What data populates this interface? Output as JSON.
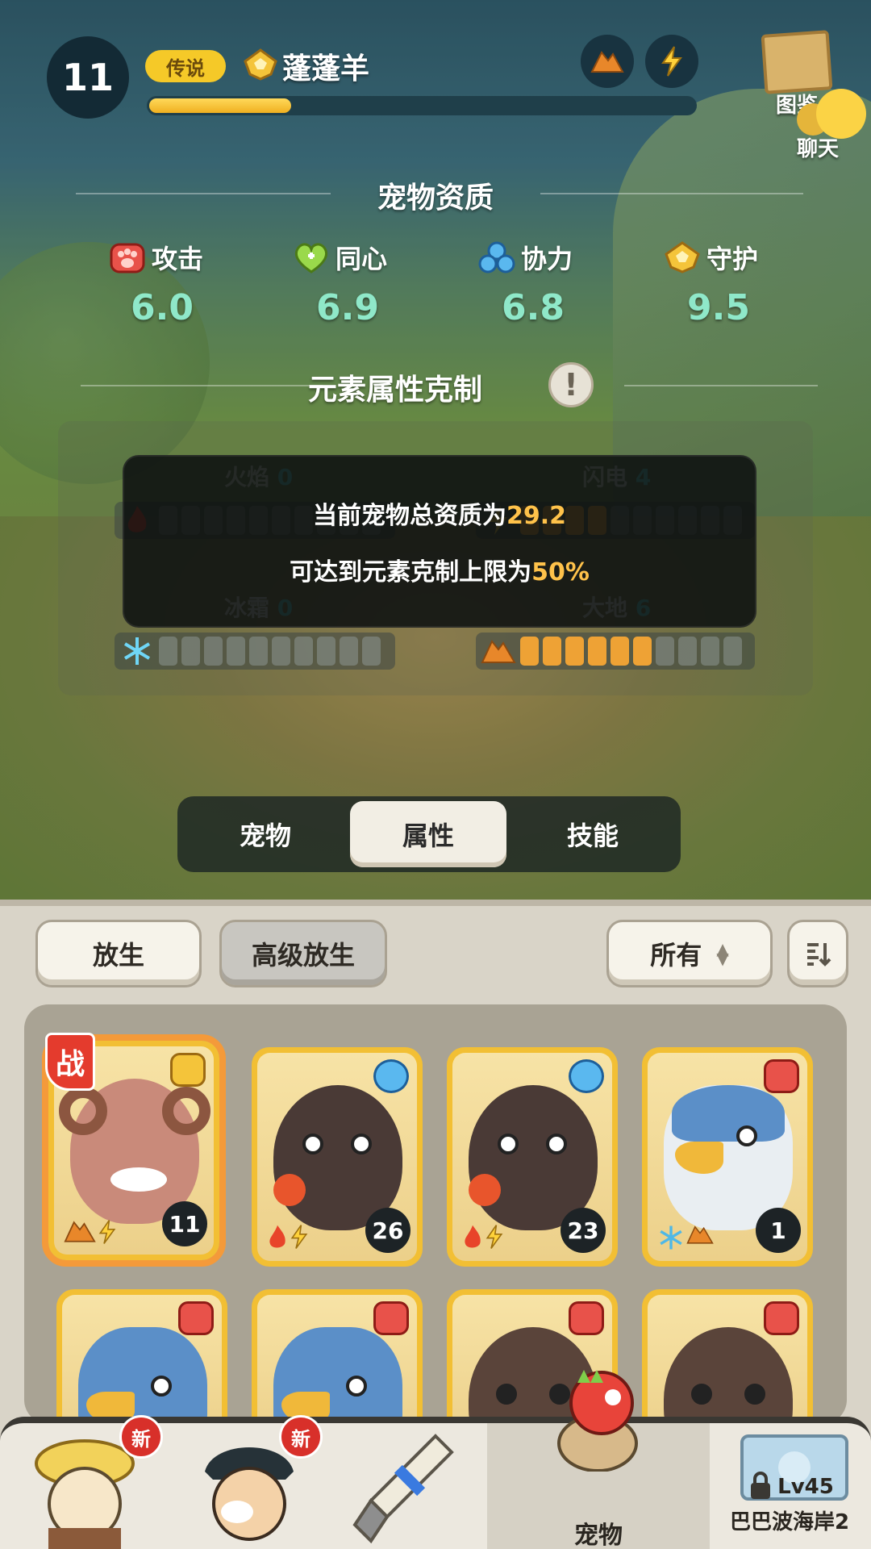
{
  "header": {
    "level": "11",
    "rarity": "传说",
    "pet_name": "蓬蓬羊",
    "exp_progress": 0.26,
    "atlas_label": "图鉴",
    "chat_label": "聊天"
  },
  "aptitude": {
    "title": "宠物资质",
    "stats": [
      {
        "label": "攻击",
        "value": "6.0",
        "icon": "attack-paw-icon"
      },
      {
        "label": "同心",
        "value": "6.9",
        "icon": "heart-icon"
      },
      {
        "label": "协力",
        "value": "6.8",
        "icon": "cooperation-icon"
      },
      {
        "label": "守护",
        "value": "9.5",
        "icon": "guard-icon"
      }
    ]
  },
  "elements": {
    "title": "元素属性克制",
    "items": [
      {
        "label": "火焰",
        "value": "0",
        "filled": 0,
        "icon": "fire-icon"
      },
      {
        "label": "闪电",
        "value": "4",
        "filled": 4,
        "icon": "lightning-icon"
      },
      {
        "label": "冰霜",
        "value": "0",
        "filled": 0,
        "icon": "snowflake-icon"
      },
      {
        "label": "大地",
        "value": "6",
        "filled": 6,
        "icon": "earth-icon"
      }
    ],
    "segments_total": 10
  },
  "tooltip": {
    "line1_prefix": "当前宠物总资质为",
    "line1_value": "29.2",
    "line2_prefix": "可达到元素克制上限为",
    "line2_value": "50%"
  },
  "tabs": [
    {
      "label": "宠物",
      "active": false
    },
    {
      "label": "属性",
      "active": true
    },
    {
      "label": "技能",
      "active": false
    }
  ],
  "toolbar": {
    "release": "放生",
    "advanced_release": "高级放生",
    "filter": "所有"
  },
  "pets": [
    {
      "level": "11",
      "in_battle": true,
      "battle_label": "战",
      "badge": "guard-icon",
      "attrs": [
        "earth-icon",
        "lightning-icon"
      ]
    },
    {
      "level": "26",
      "badge": "cooperation-icon",
      "attrs": [
        "fire-icon",
        "lightning-icon"
      ]
    },
    {
      "level": "23",
      "badge": "cooperation-icon",
      "attrs": [
        "fire-icon",
        "lightning-icon"
      ]
    },
    {
      "level": "1",
      "badge": "attack-paw-icon",
      "attrs": [
        "snowflake-icon",
        "earth-icon"
      ]
    },
    {
      "badge": "attack-paw-icon"
    },
    {
      "badge": "attack-paw-icon"
    },
    {
      "badge": "attack-paw-icon"
    },
    {
      "badge": "attack-paw-icon"
    }
  ],
  "nav": {
    "new_badge": "新",
    "pets_label": "宠物",
    "location_level": "Lv45",
    "location_name": "巴巴波海岸2"
  },
  "colors": {
    "accent_gold": "#f2bf34",
    "value_teal": "#8fe8c9",
    "highlight": "#ffc24a",
    "element_fill": "#eea235"
  }
}
